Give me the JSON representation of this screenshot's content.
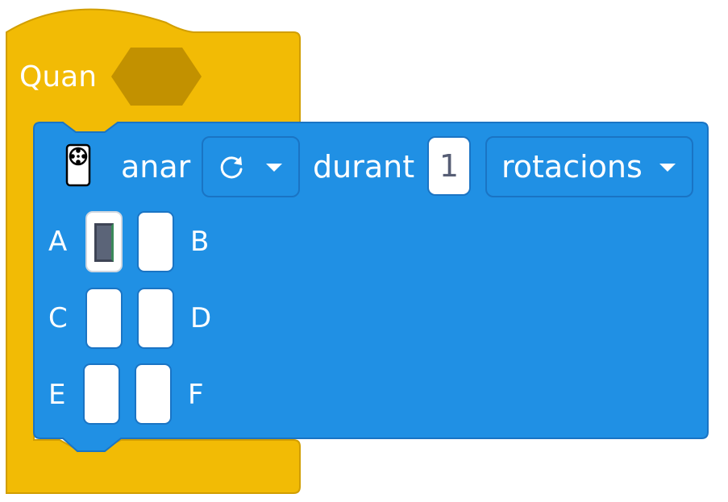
{
  "hat_block": {
    "label": "Quan",
    "color": "#f2bb05",
    "border_color": "#d19e00",
    "slot_color": "#c29100"
  },
  "motor_block": {
    "color": "#2090e4",
    "border_color": "#1a74c4",
    "icon": "motor-icon",
    "verb": "anar",
    "direction_icon": "rotate-clockwise-icon",
    "preposition": "durant",
    "amount": "1",
    "unit": "rotacions",
    "ports": [
      {
        "letter": "A",
        "selected": true
      },
      {
        "letter": "B",
        "selected": false
      },
      {
        "letter": "C",
        "selected": false
      },
      {
        "letter": "D",
        "selected": false
      },
      {
        "letter": "E",
        "selected": false
      },
      {
        "letter": "F",
        "selected": false
      }
    ]
  }
}
